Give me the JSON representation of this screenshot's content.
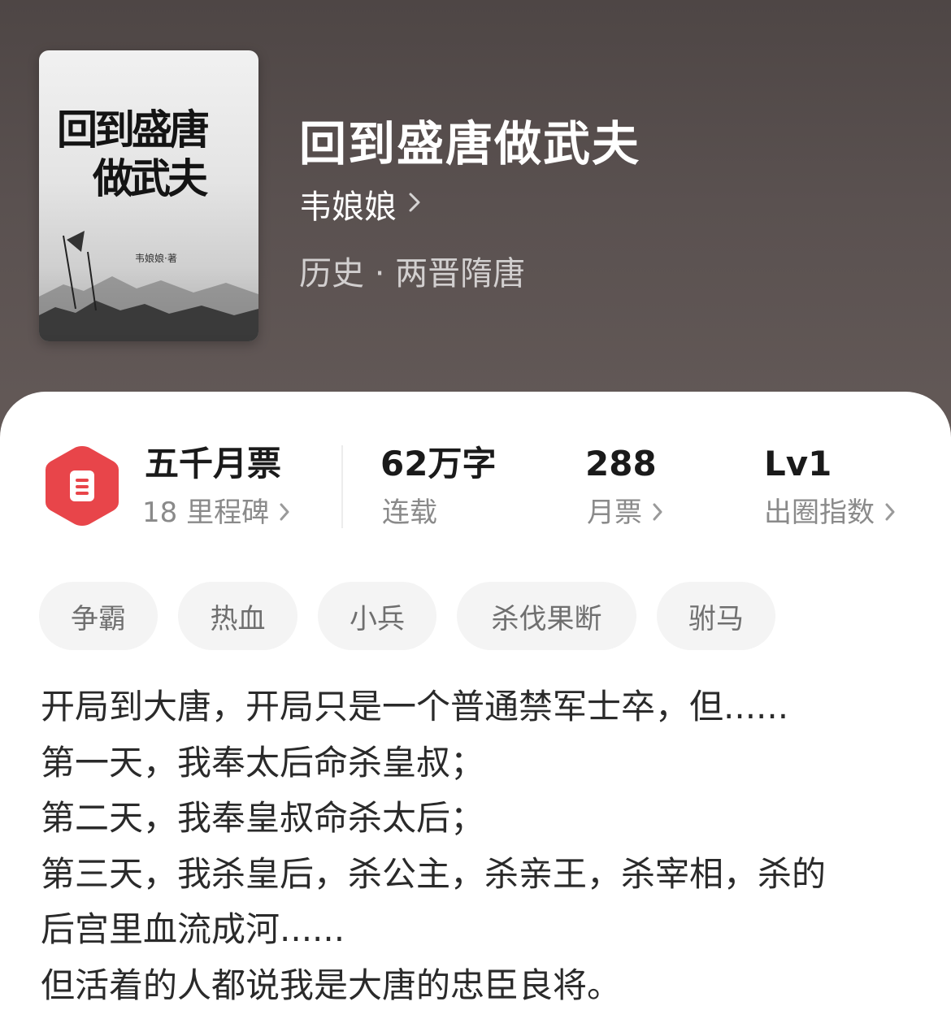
{
  "book": {
    "title": "回到盛唐做武夫",
    "author": "韦娘娘",
    "category": "历史 · 两晋隋唐",
    "cover": {
      "title_line1": "回到盛唐",
      "title_line2": "做武夫",
      "author_mark": "韦娘娘·著"
    }
  },
  "stats": {
    "milestone": {
      "label": "五千月票",
      "sub": "18 里程碑"
    },
    "words": {
      "value": "62万字",
      "sub": "连载"
    },
    "monthly_votes": {
      "value": "288",
      "sub": "月票"
    },
    "influence": {
      "value": "Lv1",
      "sub": "出圈指数"
    }
  },
  "tags": [
    "争霸",
    "热血",
    "小兵",
    "杀伐果断",
    "驸马"
  ],
  "description": [
    "开局到大唐，开局只是一个普通禁军士卒，但......",
    "第一天，我奉太后命杀皇叔；",
    "第二天，我奉皇叔命杀太后；",
    "第三天，我杀皇后，杀公主，杀亲王，杀宰相，杀的",
    "后宫里血流成河......",
    "但活着的人都说我是大唐的忠臣良将。"
  ],
  "colors": {
    "header_bg": "#574e4d",
    "badge_red": "#e8454a",
    "text_primary": "#1a1a1a",
    "text_secondary": "#8a8a8a"
  },
  "icons": {
    "badge": "ticket-hexagon-icon",
    "chevron": "chevron-right-icon"
  }
}
